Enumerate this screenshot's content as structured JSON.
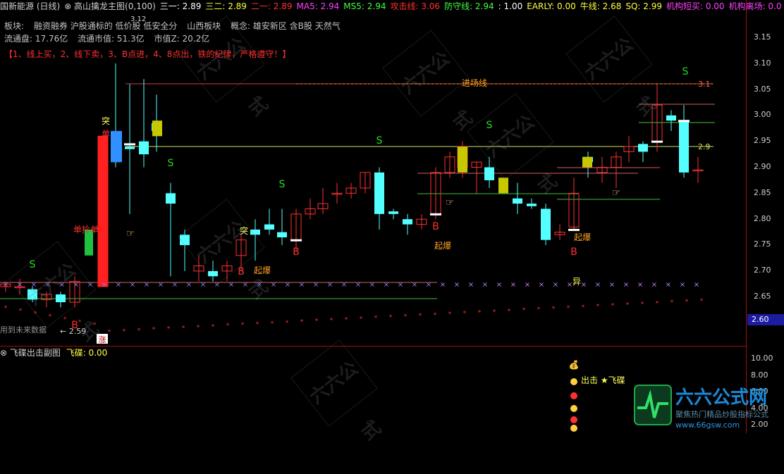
{
  "title_bar": [
    {
      "text": "国新能源 (日线)",
      "color": "#d0d0d0"
    },
    {
      "text": "⊗ 高山擒龙主图(0,100)",
      "color": "#d0d0d0"
    },
    {
      "text": "三一: 2.89",
      "color": "#ffffff"
    },
    {
      "text": "三二: 2.89",
      "color": "#ffff40"
    },
    {
      "text": "二一: 2.89",
      "color": "#ff3030"
    },
    {
      "text": "MA5: 2.94",
      "color": "#ff40ff"
    },
    {
      "text": "MS5: 2.94",
      "color": "#40ff40"
    },
    {
      "text": "攻击线: 3.06",
      "color": "#ff3030"
    },
    {
      "text": "防守线: 2.94",
      "color": "#40ff40"
    },
    {
      "text": ": 1.00",
      "color": "#ffffff"
    },
    {
      "text": "EARLY: 0.00",
      "color": "#ffff40"
    },
    {
      "text": "牛线: 2.68",
      "color": "#ffff40"
    },
    {
      "text": "SQ: 2.99",
      "color": "#ffff40"
    },
    {
      "text": "机构短买: 0.00",
      "color": "#ff40ff"
    },
    {
      "text": "机构离场: 0.0",
      "color": "#ff40ff"
    }
  ],
  "info": {
    "row1": [
      "板块:",
      "融资融券 沪股通标的 低价股 低安全分",
      "山西板块",
      "概念: 雄安新区 含B股 天然气"
    ],
    "row2": [
      "流通盘: 17.76亿",
      "流通市值: 51.3亿",
      "市值Z: 20.2亿"
    ]
  },
  "rules_text": "【1、线上买，2、线下卖，3、B点进，4、8点出，铁的纪律，严格遵守！】",
  "price_axis": [
    "3.15",
    "3.10",
    "3.05",
    "3.00",
    "2.95",
    "2.90",
    "2.85",
    "2.80",
    "2.75",
    "2.70",
    "2.65"
  ],
  "price_axis_highlight": "2.60",
  "sub_axis": [
    "10.00",
    "8.00",
    "6.00",
    "4.00",
    "2.00"
  ],
  "sub_header": "⊗ 飞碟出击副图",
  "sub_value": "飞碟: 0.00",
  "labels": {
    "entry_line": "进场线",
    "v_31": "3.1",
    "v_29": "2.9",
    "v_312": "3.12",
    "v_259": "← 2.59",
    "future_data": "用到未来数据",
    "zhang": "涨",
    "tu": "突",
    "dan": "单",
    "dan_lin_dan": "单拎单",
    "qibao": "起爆",
    "yi": "异",
    "s": "S",
    "b": "B",
    "chuji": "出击 ★飞碟"
  },
  "brand": {
    "name": "六六公式网",
    "slogan": "聚焦热门精品炒股指标公式",
    "url": "www.66gsw.com",
    "watermark": "六六公式"
  },
  "colors": {
    "up": "#ff3030",
    "down": "#54ffff",
    "bg": "#000000",
    "axis": "#a01010"
  }
}
